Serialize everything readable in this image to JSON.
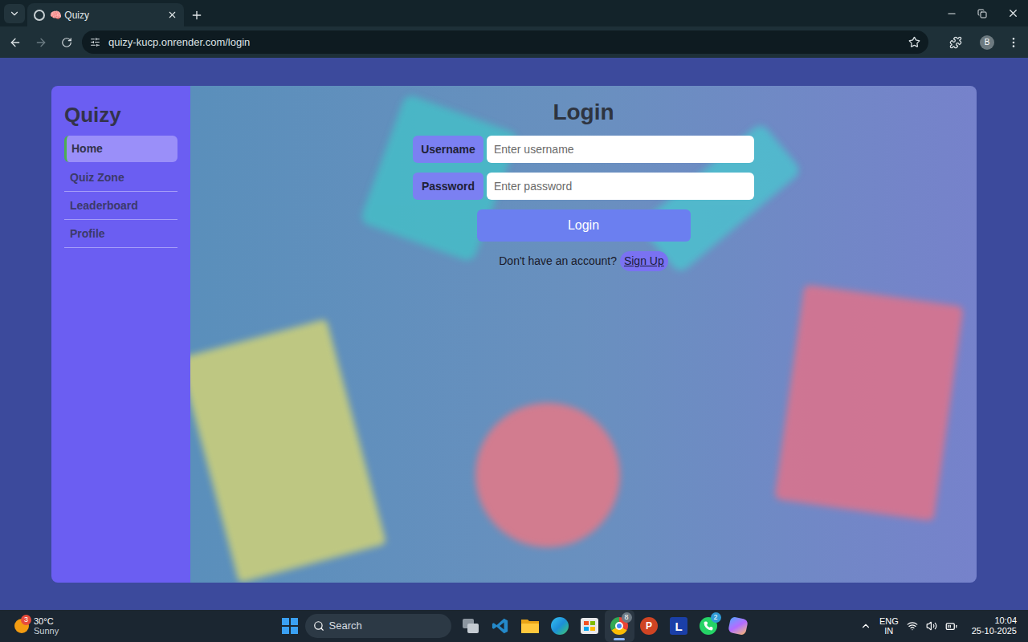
{
  "browser": {
    "tab": {
      "title": "🧠 Quizy"
    },
    "url": "quizy-kucp.onrender.com/login",
    "profile": "B"
  },
  "sidebar": {
    "title": "Quizy",
    "items": [
      {
        "label": "Home",
        "selected": true
      },
      {
        "label": "Quiz Zone",
        "selected": false
      },
      {
        "label": "Leaderboard",
        "selected": false
      },
      {
        "label": "Profile",
        "selected": false
      }
    ]
  },
  "login": {
    "title": "Login",
    "fields": [
      {
        "label": "Username",
        "placeholder": "Enter username"
      },
      {
        "label": "Password",
        "placeholder": "Enter password"
      }
    ],
    "submit": "Login",
    "prompt": "Don't have an account?",
    "link": "Sign Up"
  },
  "taskbar": {
    "weather": {
      "temp": "30°C",
      "condition": "Sunny",
      "badge": "3"
    },
    "search": "Search",
    "apps": [
      {
        "kind": "taskview",
        "selected": false
      },
      {
        "kind": "vscode",
        "selected": false
      },
      {
        "kind": "explorer",
        "selected": false
      },
      {
        "kind": "edge",
        "selected": false
      },
      {
        "kind": "store",
        "selected": false
      },
      {
        "kind": "chrome",
        "selected": true,
        "badge": "8"
      },
      {
        "kind": "powerpoint",
        "selected": false,
        "label": "P"
      },
      {
        "kind": "letter",
        "selected": false,
        "label": "L"
      },
      {
        "kind": "whatsapp",
        "selected": false,
        "badge": "2"
      },
      {
        "kind": "copilot",
        "selected": false
      }
    ],
    "language": [
      "ENG",
      "IN"
    ],
    "time": "10:04",
    "date": "25-10-2025"
  }
}
